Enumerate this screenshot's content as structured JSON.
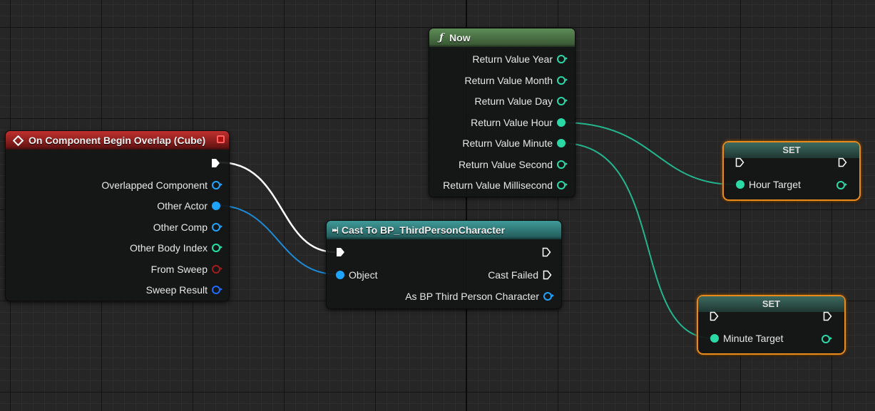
{
  "event_node": {
    "title": "On Component Begin Overlap (Cube)",
    "pins": [
      {
        "label": "Overlapped Component",
        "color": "#1ea4ff",
        "filled": false
      },
      {
        "label": "Other Actor",
        "color": "#1ea4ff",
        "filled": true
      },
      {
        "label": "Other Comp",
        "color": "#1ea4ff",
        "filled": false
      },
      {
        "label": "Other Body Index",
        "color": "#1ee6a6",
        "filled": false
      },
      {
        "label": "From Sweep",
        "color": "#a31c1c",
        "filled": false
      },
      {
        "label": "Sweep Result",
        "color": "#1e6cff",
        "filled": false
      }
    ]
  },
  "now_node": {
    "title": "Now",
    "pins": [
      {
        "label": "Return Value Year",
        "filled": false
      },
      {
        "label": "Return Value Month",
        "filled": false
      },
      {
        "label": "Return Value Day",
        "filled": false
      },
      {
        "label": "Return Value Hour",
        "filled": true
      },
      {
        "label": "Return Value Minute",
        "filled": true
      },
      {
        "label": "Return Value Second",
        "filled": false
      },
      {
        "label": "Return Value Millisecond",
        "filled": false
      }
    ],
    "pin_color": "#2ad9a6"
  },
  "cast_node": {
    "title": "Cast To BP_ThirdPersonCharacter",
    "object_label": "Object",
    "cast_failed_label": "Cast Failed",
    "as_label": "As BP Third Person Character"
  },
  "set_hour": {
    "title": "SET",
    "var_label": "Hour Target"
  },
  "set_minute": {
    "title": "SET",
    "var_label": "Minute Target"
  },
  "colors": {
    "exec": "#ffffff",
    "object_pin": "#1ea4ff",
    "int_pin": "#2ad9a6",
    "set_border": "#e88a1c"
  }
}
